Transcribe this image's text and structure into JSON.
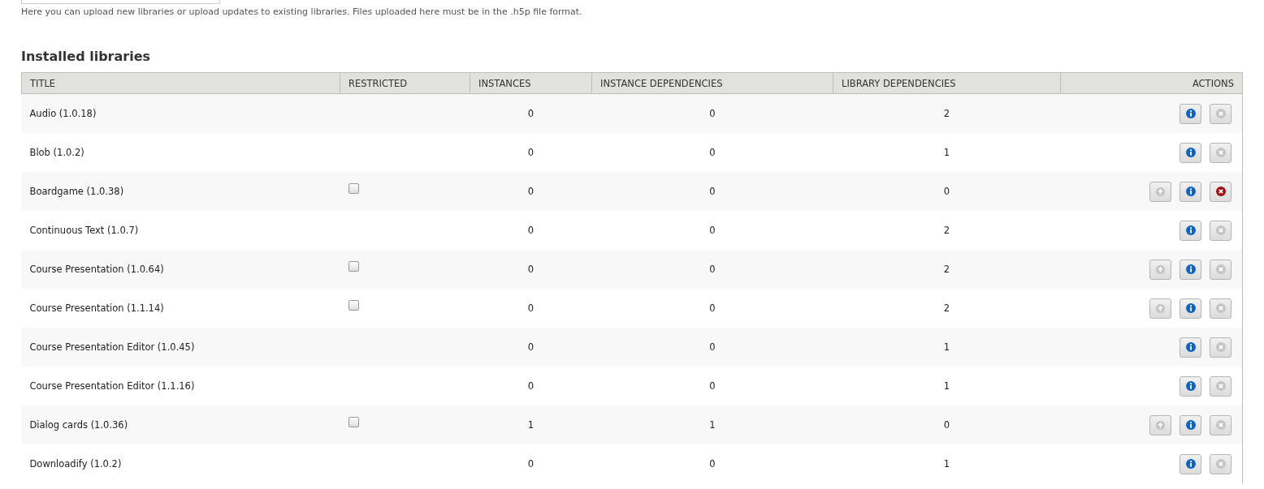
{
  "upload_description": "Here you can upload new libraries or upload updates to existing libraries. Files uploaded here must be in the .h5p file format.",
  "heading": "Installed libraries",
  "table": {
    "columns": [
      "TITLE",
      "RESTRICTED",
      "INSTANCES",
      "INSTANCE DEPENDENCIES",
      "LIBRARY DEPENDENCIES",
      "ACTIONS"
    ],
    "rows": [
      {
        "title": "Audio (1.0.18)",
        "instances": "0",
        "instance_dependencies": "0",
        "library_dependencies": "2",
        "upgrade_available": false,
        "delete_disabled": true
      },
      {
        "title": "Blob (1.0.2)",
        "instances": "0",
        "instance_dependencies": "0",
        "library_dependencies": "1",
        "upgrade_available": false,
        "delete_disabled": true
      },
      {
        "title": "Boardgame (1.0.38)",
        "restricted": false,
        "instances": "0",
        "instance_dependencies": "0",
        "library_dependencies": "0",
        "upgrade_available": true,
        "delete_disabled": false
      },
      {
        "title": "Continuous Text (1.0.7)",
        "instances": "0",
        "instance_dependencies": "0",
        "library_dependencies": "2",
        "upgrade_available": false,
        "delete_disabled": true
      },
      {
        "title": "Course Presentation (1.0.64)",
        "restricted": false,
        "instances": "0",
        "instance_dependencies": "0",
        "library_dependencies": "2",
        "upgrade_available": true,
        "delete_disabled": true
      },
      {
        "title": "Course Presentation (1.1.14)",
        "restricted": false,
        "instances": "0",
        "instance_dependencies": "0",
        "library_dependencies": "2",
        "upgrade_available": true,
        "delete_disabled": true
      },
      {
        "title": "Course Presentation Editor (1.0.45)",
        "instances": "0",
        "instance_dependencies": "0",
        "library_dependencies": "1",
        "upgrade_available": false,
        "delete_disabled": true
      },
      {
        "title": "Course Presentation Editor (1.1.16)",
        "instances": "0",
        "instance_dependencies": "0",
        "library_dependencies": "1",
        "upgrade_available": false,
        "delete_disabled": true
      },
      {
        "title": "Dialog cards (1.0.36)",
        "restricted": false,
        "instances": "1",
        "instance_dependencies": "1",
        "library_dependencies": "0",
        "upgrade_available": true,
        "delete_disabled": true
      },
      {
        "title": "Downloadify (1.0.2)",
        "instances": "0",
        "instance_dependencies": "0",
        "library_dependencies": "1",
        "upgrade_available": false,
        "delete_disabled": true
      }
    ]
  }
}
